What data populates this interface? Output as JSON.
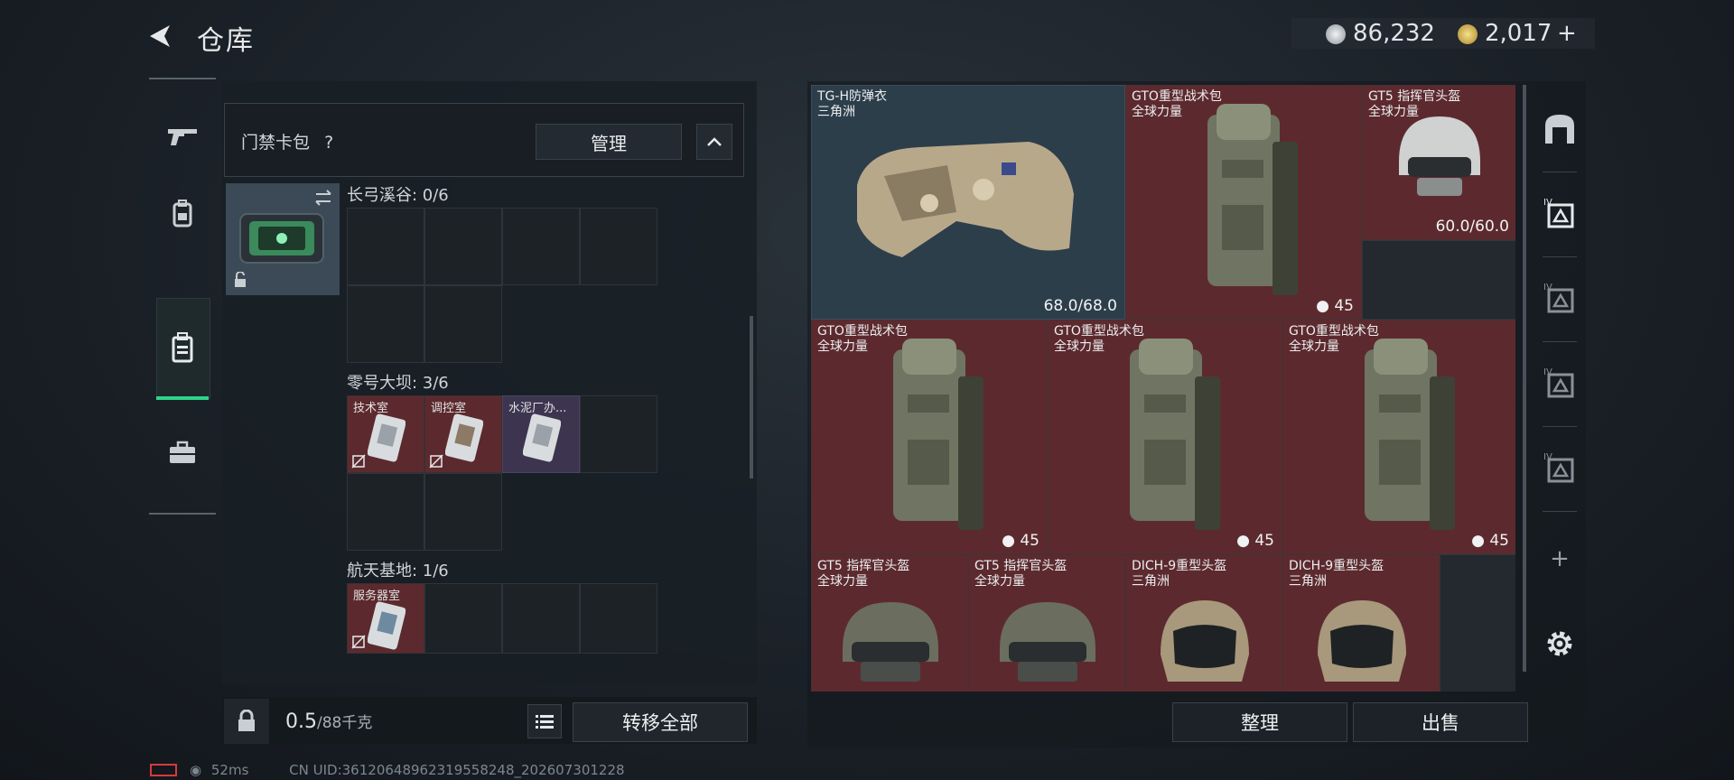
{
  "header": {
    "title": "仓库",
    "currency": [
      {
        "icon": "silver-coin-icon",
        "value": "86,232"
      },
      {
        "icon": "gold-coin-icon",
        "value": "2,017"
      }
    ],
    "add_label": "+"
  },
  "left_rail": [
    {
      "icon": "gun-icon"
    },
    {
      "icon": "backpack-icon"
    },
    {
      "icon": "card-case-icon",
      "active": true
    },
    {
      "icon": "briefcase-icon"
    }
  ],
  "card_wallet": {
    "label": "门禁卡包",
    "help": "?",
    "manage_label": "管理",
    "sections": [
      {
        "name": "长弓溪谷: 0/6",
        "keys": []
      },
      {
        "name": "零号大坝: 3/6",
        "keys": [
          "技术室",
          "调控室",
          "水泥厂办..."
        ]
      },
      {
        "name": "航天基地: 1/6",
        "keys": [
          "服务器室"
        ]
      }
    ]
  },
  "weight": {
    "value": "0.5",
    "max": "/88千克"
  },
  "transfer_all_label": "转移全部",
  "inventory": {
    "items": [
      {
        "name": "TG-H防弹衣",
        "sub": "三角洲",
        "stat": "68.0/68.0"
      },
      {
        "name": "GTO重型战术包",
        "sub": "全球力量",
        "stat": "45"
      },
      {
        "name": "GT5 指挥官头盔",
        "sub": "全球力量",
        "stat": "60.0/60.0"
      },
      {
        "name": "GTO重型战术包",
        "sub": "全球力量",
        "stat": "45"
      },
      {
        "name": "GTO重型战术包",
        "sub": "全球力量",
        "stat": "45"
      },
      {
        "name": "GTO重型战术包",
        "sub": "全球力量",
        "stat": "45"
      },
      {
        "name": "GT5 指挥官头盔",
        "sub": "全球力量",
        "stat": ""
      },
      {
        "name": "GT5 指挥官头盔",
        "sub": "全球力量",
        "stat": ""
      },
      {
        "name": "DICH-9重型头盔",
        "sub": "三角洲",
        "stat": ""
      },
      {
        "name": "DICH-9重型头盔",
        "sub": "三角洲",
        "stat": ""
      }
    ],
    "sort_label": "整理",
    "sell_label": "出售"
  },
  "right_rail": [
    {
      "icon": "container-icon"
    },
    {
      "icon": "level-iv-case-icon"
    },
    {
      "icon": "level-iv-case-icon"
    },
    {
      "icon": "level-iv-case-icon"
    },
    {
      "icon": "level-iv-case-icon"
    },
    {
      "icon": "plus-icon",
      "label": "+"
    },
    {
      "icon": "gear-icon"
    }
  ],
  "footer": {
    "ping": "52ms",
    "uid": "CN UID:3612064896231955824​8_202607301228"
  },
  "colors": {
    "accent_green": "#2fd38a",
    "rarity_red": "#5c2a2e",
    "rarity_blue": "#2d3e4b",
    "rarity_purple": "#3d3550"
  }
}
